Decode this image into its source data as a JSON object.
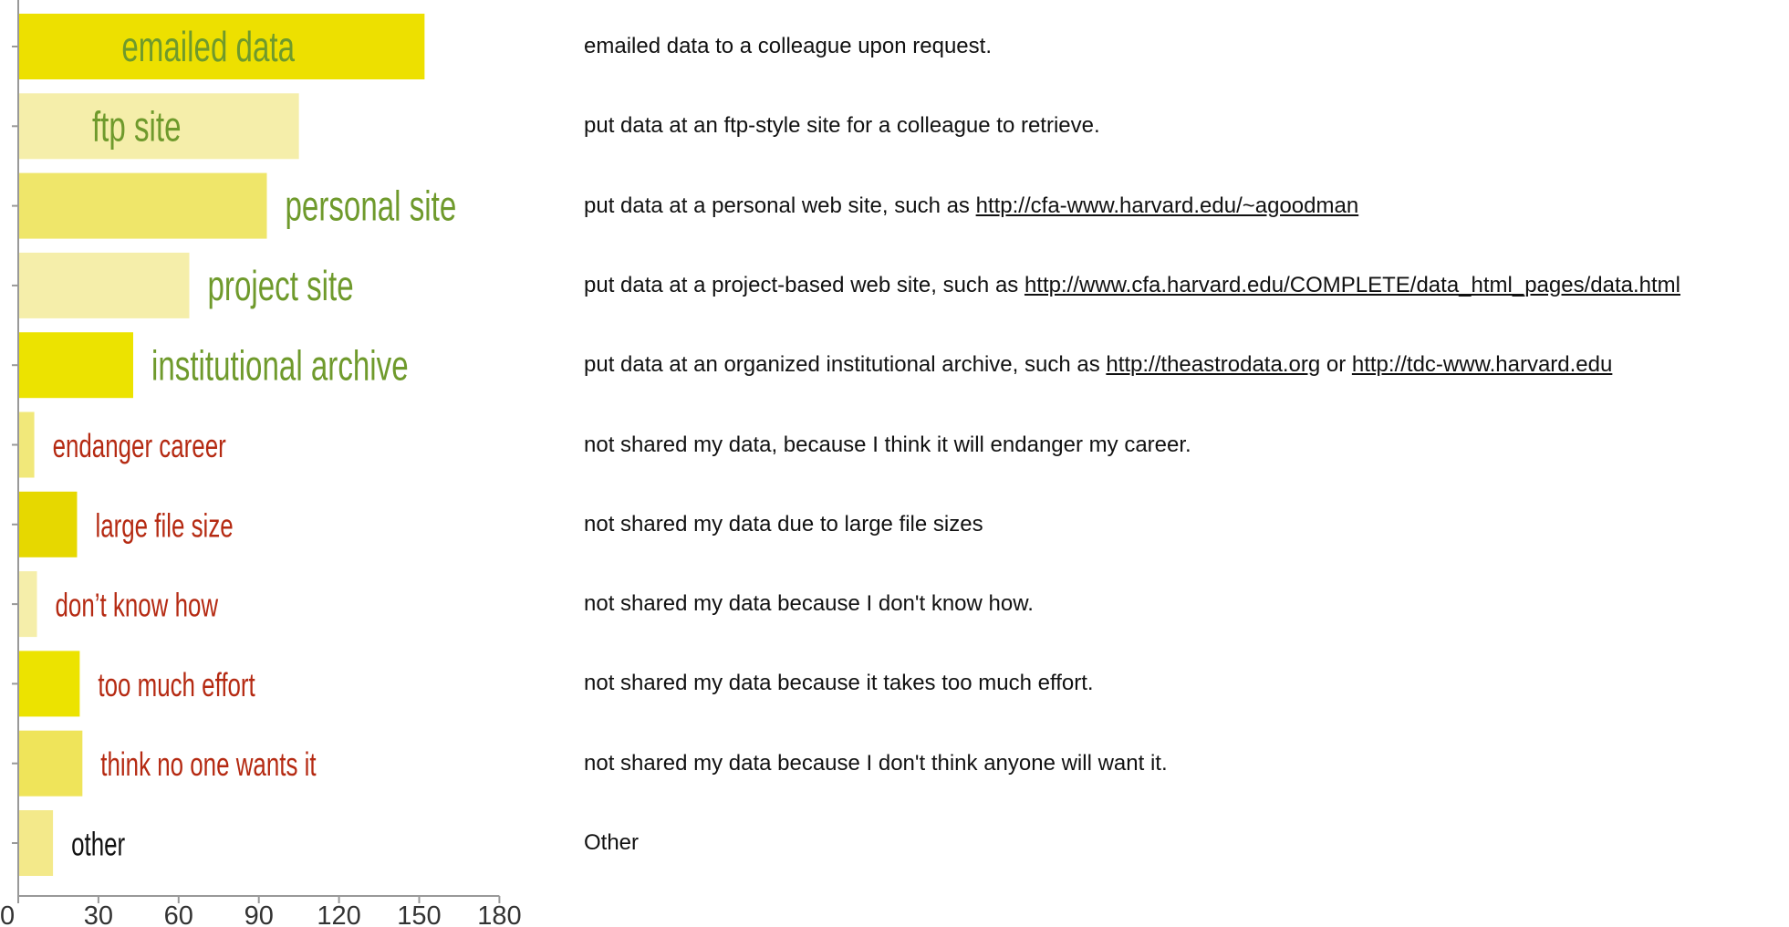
{
  "chart_data": {
    "type": "bar",
    "orientation": "horizontal",
    "categories": [
      "emailed data",
      "ftp site",
      "personal site",
      "project site",
      "institutional archive",
      "endanger career",
      "large file size",
      "don’t know how",
      "too much effort",
      "think no one wants it",
      "other"
    ],
    "values": [
      152,
      105,
      93,
      64,
      43,
      6,
      22,
      7,
      23,
      24,
      13
    ],
    "xlim": [
      0,
      180
    ],
    "xticks": [
      "0",
      "30",
      "60",
      "90",
      "120",
      "150",
      "180"
    ],
    "title": "",
    "xlabel": "",
    "ylabel": "",
    "grid": false,
    "label_colors": [
      "#6f9a2c",
      "#6f9a2c",
      "#6f9a2c",
      "#6f9a2c",
      "#6f9a2c",
      "#b52a12",
      "#b52a12",
      "#b52a12",
      "#b52a12",
      "#b52a12",
      "#111111"
    ],
    "bar_colors": [
      "#ede000",
      "#f5eeaa",
      "#efe66a",
      "#f5eeaa",
      "#ece300",
      "#f1e87a",
      "#e6d800",
      "#f5eeaa",
      "#ece300",
      "#efe45a",
      "#f3e98a"
    ]
  },
  "descriptions": [
    {
      "text": "emailed data to a colleague upon request.",
      "link": "",
      "mid": "",
      "link2": ""
    },
    {
      "text": "put data at an ftp-style site for a colleague to retrieve.",
      "link": "",
      "mid": "",
      "link2": ""
    },
    {
      "text": "put data at a personal web site, such as ",
      "link": "http://cfa-www.harvard.edu/~agoodman",
      "mid": "",
      "link2": ""
    },
    {
      "text": "put data at a project-based web site, such as ",
      "link": "http://www.cfa.harvard.edu/COMPLETE/data_html_pages/data.html",
      "mid": "",
      "link2": ""
    },
    {
      "text": "put data at an organized institutional archive, such as ",
      "link": "http://theastrodata.org",
      "mid": " or ",
      "link2": "http://tdc-www.harvard.edu"
    },
    {
      "text": "not shared my data, because I think it will endanger my career.",
      "link": "",
      "mid": "",
      "link2": ""
    },
    {
      "text": "not shared my data due to large file sizes",
      "link": "",
      "mid": "",
      "link2": ""
    },
    {
      "text": "not shared my data because I don't know how.",
      "link": "",
      "mid": "",
      "link2": ""
    },
    {
      "text": "not shared my data because it takes too much effort.",
      "link": "",
      "mid": "",
      "link2": ""
    },
    {
      "text": "not shared my data because I don't think anyone will want it.",
      "link": "",
      "mid": "",
      "link2": ""
    },
    {
      "text": "Other",
      "link": "",
      "mid": "",
      "link2": ""
    }
  ]
}
